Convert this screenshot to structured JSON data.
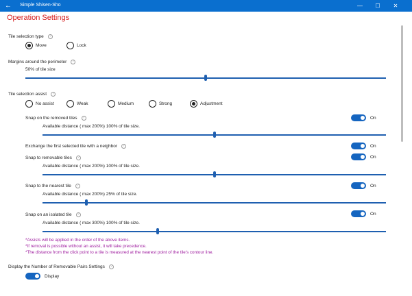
{
  "window": {
    "title": "Simple Shisen-Sho",
    "back_glyph": "←",
    "minimize_glyph": "—",
    "maximize_glyph": "☐",
    "close_glyph": "✕"
  },
  "page": {
    "title": "Operation Settings"
  },
  "help_glyph": "?",
  "tile_selection_type": {
    "label": "Tile selection type",
    "options": [
      "Move",
      "Lock"
    ],
    "selected": "Move"
  },
  "margins": {
    "label": "Margins around the perimeter",
    "value_text": "50% of tile size",
    "value_percent": 50
  },
  "tile_selection_assist": {
    "label": "Tile selection assist",
    "options": [
      "No assist",
      "Weak",
      "Medium",
      "Strong",
      "Adjustment"
    ],
    "selected": "Adjustment"
  },
  "assists": [
    {
      "label": "Snap on the removed tiles",
      "toggle": "On",
      "distance_text": "Available distance ( max 200%) 100% of tile size.",
      "value_fraction": 0.5
    },
    {
      "label": "Exchange the first selected tile with a neighbor",
      "toggle": "On"
    },
    {
      "label": "Snap to removable tiles",
      "toggle": "On",
      "distance_text": "Available distance ( max 200%) 100% of tile size.",
      "value_fraction": 0.5
    },
    {
      "label": "Snap to the nearest tile",
      "toggle": "On",
      "distance_text": "Available distance ( max 200%) 25% of tile size.",
      "value_fraction": 0.125
    },
    {
      "label": "Snap on an isolated tile",
      "toggle": "On",
      "distance_text": "Available distance ( max 300%) 100% of tile size.",
      "value_fraction": 0.333
    }
  ],
  "notes": [
    "*Assists will be applied in the order of the above items.",
    "*If removal is possible without an assist, it will take precedence.",
    "*The distance from the click point to a tile is measured at the nearest point of the tile's contour line."
  ],
  "removable_pairs": {
    "label": "Display the Number of Removable Pairs Settings",
    "toggle_label": "Display"
  },
  "colors": {
    "titlebar": "#0a6fcf",
    "page_title": "#d61c1c",
    "accent": "#1e5fb0",
    "note": "#a020a0"
  }
}
